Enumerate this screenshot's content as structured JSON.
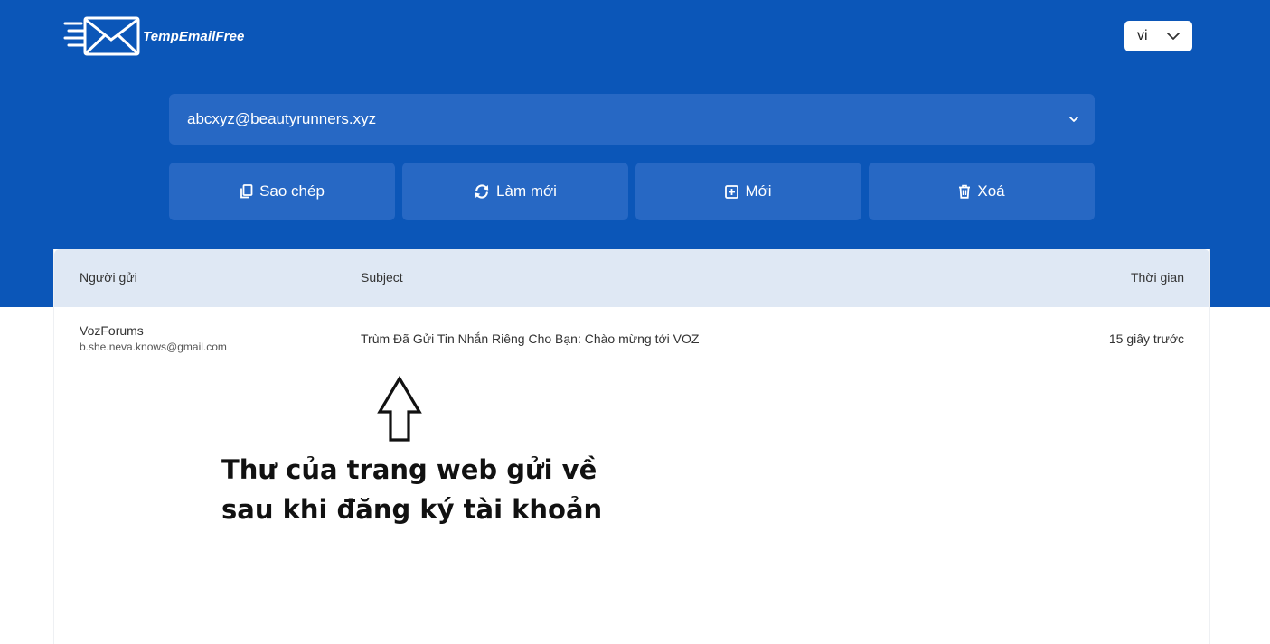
{
  "brand": {
    "name": "TempEmailFree",
    "logo_icon": "envelope-speed-icon"
  },
  "language": {
    "selected": "vi",
    "icon": "chevron-down-icon"
  },
  "email_select": {
    "value": "abcxyz@beautyrunners.xyz",
    "icon": "chevron-down-icon"
  },
  "actions": [
    {
      "label": "Sao chép",
      "icon": "copy-icon"
    },
    {
      "label": "Làm mới",
      "icon": "refresh-icon"
    },
    {
      "label": "Mới",
      "icon": "plus-square-icon"
    },
    {
      "label": "Xoá",
      "icon": "trash-icon"
    }
  ],
  "inbox": {
    "columns": {
      "sender": "Người gửi",
      "subject": "Subject",
      "time": "Thời gian"
    },
    "messages": [
      {
        "sender_name": "VozForums",
        "sender_email": "b.she.neva.knows@gmail.com",
        "subject": "Trùm Đã Gửi Tin Nhắn Riêng Cho Bạn: Chào mừng tới VOZ",
        "time": "15 giây trước"
      }
    ]
  },
  "annotation": {
    "line1": "Thư của trang web gửi về",
    "line2": "sau khi đăng ký tài khoản",
    "icon": "up-arrow-icon"
  },
  "colors": {
    "header_bg": "#0b56b8",
    "control_bg": "#2768c4",
    "table_header_bg": "#dfe8f4"
  }
}
